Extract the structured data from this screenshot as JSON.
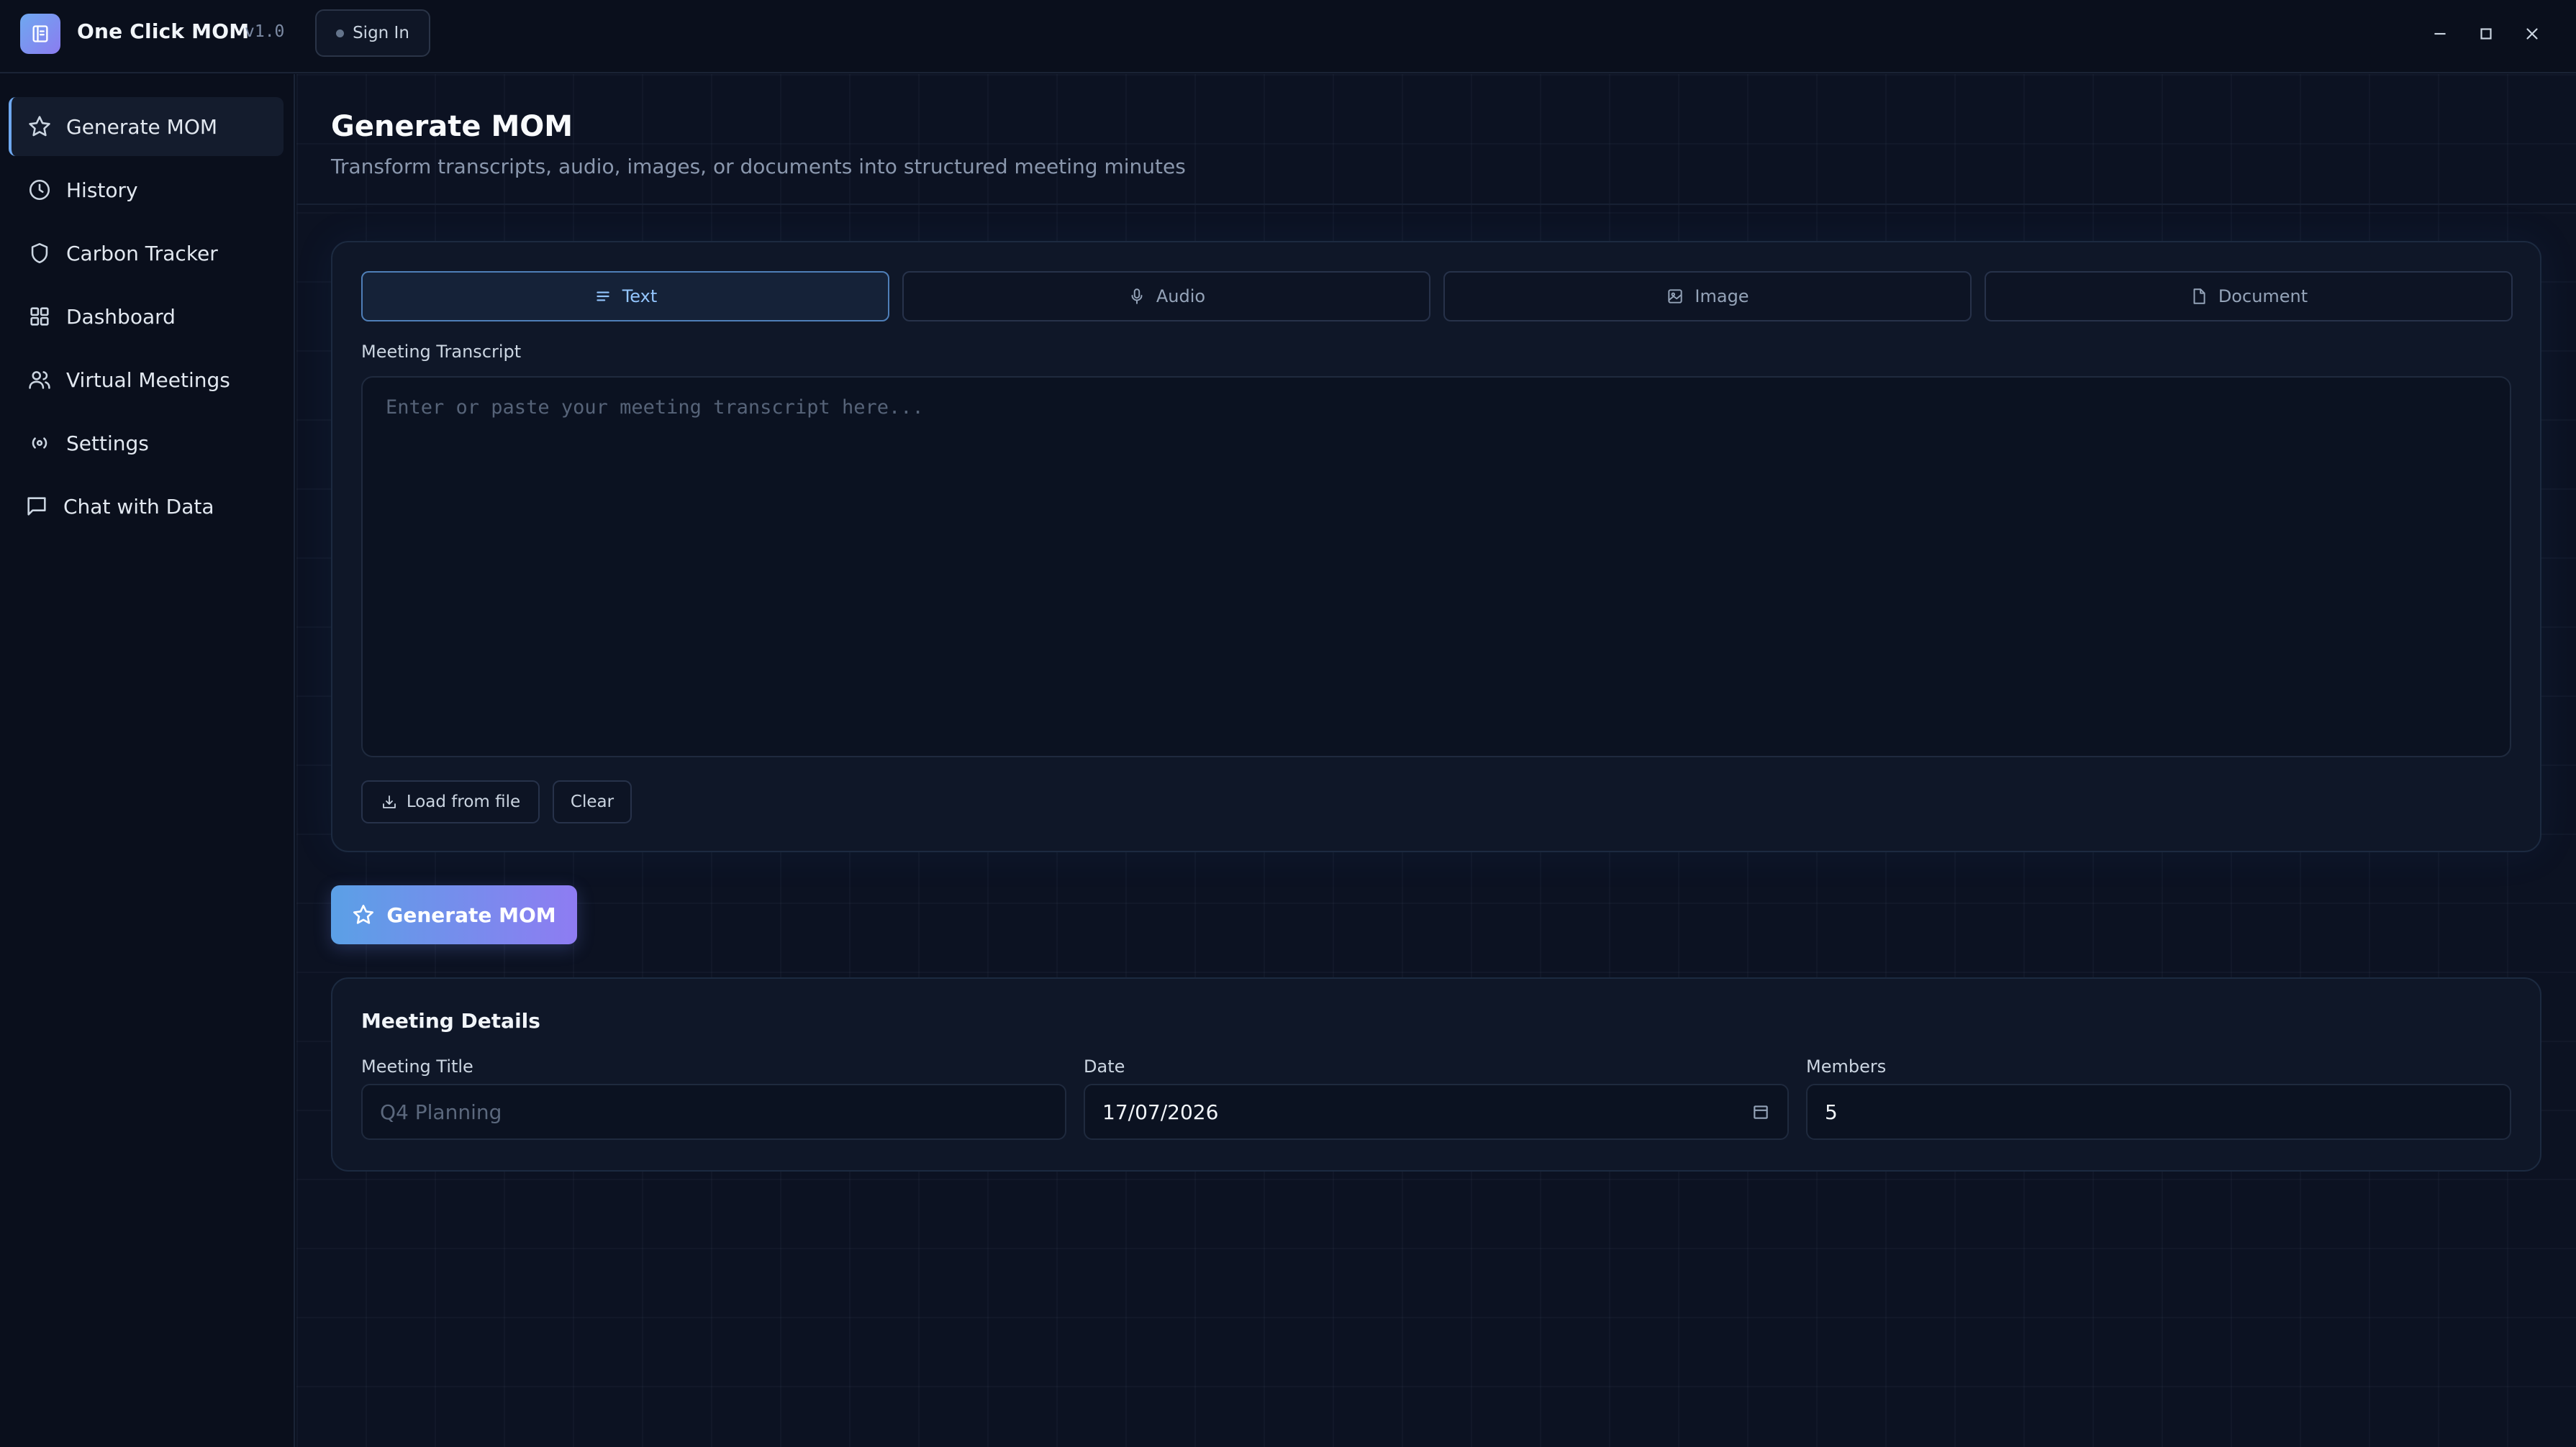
{
  "app": {
    "name": "One Click MOM",
    "version": "v1.0",
    "sign_in_label": "Sign In"
  },
  "sidebar": {
    "items": [
      {
        "label": "Generate MOM",
        "icon": "star-icon",
        "active": true
      },
      {
        "label": "History",
        "icon": "clock-icon",
        "active": false
      },
      {
        "label": "Carbon Tracker",
        "icon": "shield-icon",
        "active": false
      },
      {
        "label": "Dashboard",
        "icon": "grid-icon",
        "active": false
      },
      {
        "label": "Virtual Meetings",
        "icon": "users-icon",
        "active": false
      },
      {
        "label": "Settings",
        "icon": "broadcast-icon",
        "active": false
      },
      {
        "label": "Chat with Data",
        "icon": "message-square-icon",
        "active": false
      }
    ]
  },
  "page": {
    "title": "Generate MOM",
    "subtitle": "Transform transcripts, audio, images, or documents into structured meeting minutes"
  },
  "input": {
    "tabs": [
      {
        "label": "Text",
        "icon": "text-lines-icon",
        "active": true
      },
      {
        "label": "Audio",
        "icon": "microphone-icon",
        "active": false
      },
      {
        "label": "Image",
        "icon": "image-icon",
        "active": false
      },
      {
        "label": "Document",
        "icon": "file-icon",
        "active": false
      }
    ],
    "transcript_label": "Meeting Transcript",
    "transcript_placeholder": "Enter or paste your meeting transcript here...",
    "transcript_value": "",
    "load_from_file_label": "Load from file",
    "clear_label": "Clear"
  },
  "generate_button_label": "Generate MOM",
  "details": {
    "heading": "Meeting Details",
    "title_label": "Meeting Title",
    "title_placeholder": "Q4 Planning",
    "title_value": "",
    "date_label": "Date",
    "date_value": "17/07/2026",
    "members_label": "Members",
    "members_value": "5"
  },
  "colors": {
    "accent_blue": "#6ea8f0",
    "accent_purple": "#8e7cf2",
    "background": "#0b1120"
  }
}
